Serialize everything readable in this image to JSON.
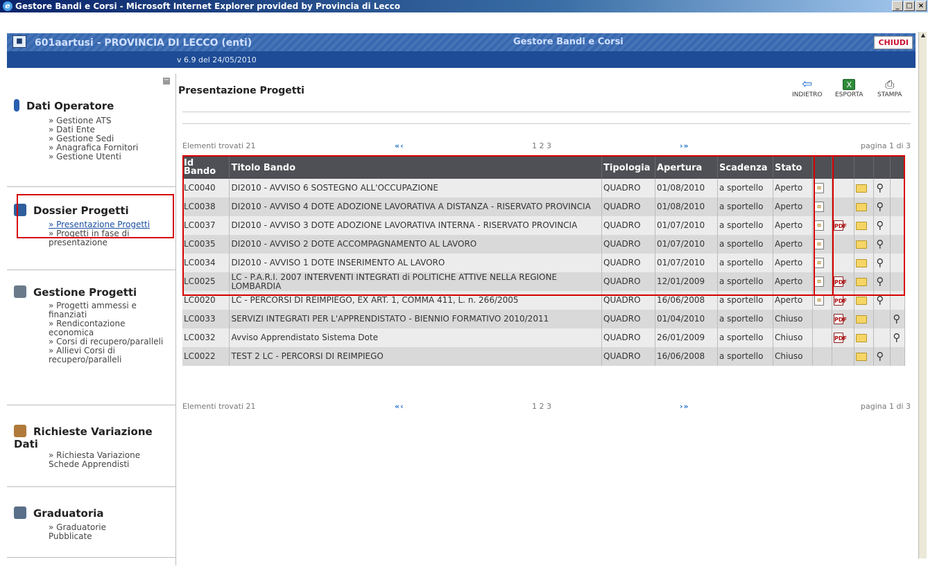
{
  "window": {
    "title": "Gestore Bandi e Corsi - Microsoft Internet Explorer provided by Provincia di Lecco",
    "min": "_",
    "max": "□",
    "close": "×"
  },
  "header": {
    "user": "601aartusi - PROVINCIA DI LECCO (enti)",
    "app": "Gestore Bandi e Corsi",
    "close_label": "CHIUDI",
    "version": "v 6.9 del 24/05/2010"
  },
  "sidebar": {
    "collapse": "−",
    "sections": [
      {
        "title": "Dati Operatore",
        "icon": "info-icon",
        "links": [
          "» Gestione ATS",
          "» Dati Ente",
          "» Gestione Sedi",
          "» Anagrafica Fornitori",
          "» Gestione Utenti"
        ]
      },
      {
        "title": "Dossier Progetti",
        "icon": "dossier-icon",
        "links": [
          "» Presentazione Progetti",
          "» Progetti in fase di presentazione"
        ]
      },
      {
        "title": "Gestione Progetti",
        "icon": "manage-icon",
        "links": [
          "» Progetti ammessi e finanziati",
          "» Rendicontazione economica",
          "» Corsi di recupero/paralleli",
          "» Allievi Corsi di recupero/paralleli"
        ]
      },
      {
        "title": "Richieste Variazione Dati",
        "icon": "change-icon",
        "links": [
          "» Richiesta Variazione Schede Apprendisti"
        ]
      },
      {
        "title": "Graduatoria",
        "icon": "ranking-icon",
        "links": [
          "» Graduatorie Pubblicate"
        ]
      }
    ]
  },
  "main": {
    "title": "Presentazione Progetti",
    "toolbar": {
      "back": "INDIETRO",
      "export": "ESPORTA",
      "print": "STAMPA"
    },
    "pager": {
      "count": "Elementi trovati 21",
      "prev": "«‹",
      "pages": "1 2 3",
      "next": "›»",
      "page": "pagina 1 di 3"
    },
    "columns": [
      "Id Bando",
      "Titolo Bando",
      "Tipologia",
      "Apertura",
      "Scadenza",
      "Stato"
    ],
    "rows": [
      {
        "id": "LC0040",
        "title": "DI2010 - AVVISO 6 SOSTEGNO ALL'OCCUPAZIONE",
        "tipo": "QUADRO",
        "apertura": "01/08/2010",
        "scadenza": "a sportello",
        "stato": "Aperto",
        "doc": true,
        "pdf": false,
        "folder": true,
        "search": true
      },
      {
        "id": "LC0038",
        "title": "DI2010 - AVVISO 4 DOTE ADOZIONE LAVORATIVA A DISTANZA - RISERVATO PROVINCIA",
        "tipo": "QUADRO",
        "apertura": "01/08/2010",
        "scadenza": "a sportello",
        "stato": "Aperto",
        "doc": true,
        "pdf": false,
        "folder": true,
        "search": true
      },
      {
        "id": "LC0037",
        "title": "DI2010 - AVVISO 3 DOTE ADOZIONE LAVORATIVA INTERNA - RISERVATO PROVINCIA",
        "tipo": "QUADRO",
        "apertura": "01/07/2010",
        "scadenza": "a sportello",
        "stato": "Aperto",
        "doc": true,
        "pdf": true,
        "folder": true,
        "search": true
      },
      {
        "id": "LC0035",
        "title": "DI2010 - AVVISO 2 DOTE ACCOMPAGNAMENTO AL LAVORO",
        "tipo": "QUADRO",
        "apertura": "01/07/2010",
        "scadenza": "a sportello",
        "stato": "Aperto",
        "doc": true,
        "pdf": false,
        "folder": true,
        "search": true
      },
      {
        "id": "LC0034",
        "title": "DI2010 - AVVISO 1 DOTE INSERIMENTO AL LAVORO",
        "tipo": "QUADRO",
        "apertura": "01/07/2010",
        "scadenza": "a sportello",
        "stato": "Aperto",
        "doc": true,
        "pdf": false,
        "folder": true,
        "search": true
      },
      {
        "id": "LC0025",
        "title": "LC - P.A.R.I. 2007 INTERVENTI INTEGRATI di POLITICHE ATTIVE NELLA REGIONE LOMBARDIA",
        "tipo": "QUADRO",
        "apertura": "12/01/2009",
        "scadenza": "a sportello",
        "stato": "Aperto",
        "doc": true,
        "pdf": true,
        "folder": true,
        "search": true
      },
      {
        "id": "LC0020",
        "title": "LC - PERCORSI DI REIMPIEGO, EX ART. 1, COMMA 411, L. n. 266/2005",
        "tipo": "QUADRO",
        "apertura": "16/06/2008",
        "scadenza": "a sportello",
        "stato": "Aperto",
        "doc": true,
        "pdf": true,
        "folder": true,
        "search": true
      },
      {
        "id": "LC0033",
        "title": "SERVIZI INTEGRATI PER L'APPRENDISTATO - BIENNIO FORMATIVO 2010/2011",
        "tipo": "QUADRO",
        "apertura": "01/04/2010",
        "scadenza": "a sportello",
        "stato": "Chiuso",
        "doc": false,
        "pdf": true,
        "folder": true,
        "search": true
      },
      {
        "id": "LC0032",
        "title": "Avviso Apprendistato Sistema Dote",
        "tipo": "QUADRO",
        "apertura": "26/01/2009",
        "scadenza": "a sportello",
        "stato": "Chiuso",
        "doc": false,
        "pdf": true,
        "folder": true,
        "search": true
      },
      {
        "id": "LC0022",
        "title": "TEST 2 LC - PERCORSI DI REIMPIEGO",
        "tipo": "QUADRO",
        "apertura": "16/06/2008",
        "scadenza": "a sportello",
        "stato": "Chiuso",
        "doc": false,
        "pdf": false,
        "folder": true,
        "search": true
      }
    ]
  },
  "colors": {
    "highlight": "#d60000",
    "header_bar": "#3768b0",
    "table_header": "#4f5055"
  }
}
